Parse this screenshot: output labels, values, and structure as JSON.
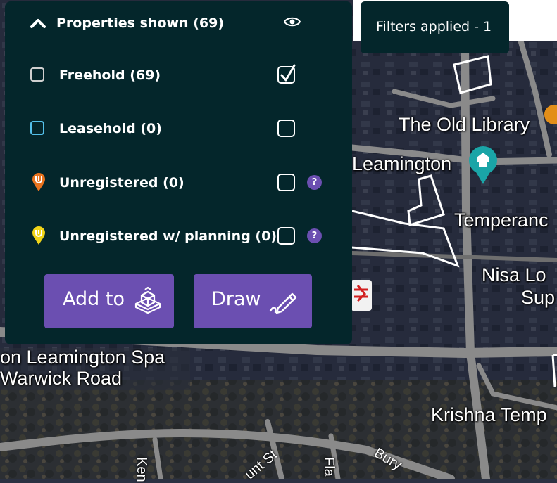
{
  "panel": {
    "title": "Properties shown (69)",
    "rows": [
      {
        "label": "Freehold (69)",
        "checked": true
      },
      {
        "label": "Leasehold (0)",
        "checked": false
      },
      {
        "label": "Unregistered (0)",
        "checked": false,
        "help": "?"
      },
      {
        "label": "Unregistered w/ planning (0)",
        "checked": false,
        "help": "?"
      }
    ],
    "buttons": {
      "add_to": "Add to",
      "draw": "Draw"
    }
  },
  "filters_badge": "Filters applied - 1",
  "map": {
    "labels": {
      "old_library": "The Old Library",
      "leamington": "Leamington",
      "temperance": "Temperanc",
      "nisa_1": "Nisa Lo",
      "nisa_2": "Sup",
      "spa": "on Leamington Spa",
      "warwick_road": "Warwick Road",
      "krishna": "Krishna Temp"
    },
    "streets": {
      "ken": "Ken",
      "unt_st": "unt St",
      "fla": "Fla",
      "bury": "Bury"
    }
  },
  "colors": {
    "panel_bg": "#04262b",
    "accent_purple": "#6b4fb1",
    "leasehold_blue": "#54c0ea",
    "unregistered_orange": "#e8731e",
    "planning_yellow": "#f1d418"
  },
  "icons": {
    "chevron": "chevron-up-icon",
    "eye": "eye-icon",
    "add_to": "building-stack-icon",
    "draw": "pencil-draw-icon"
  }
}
